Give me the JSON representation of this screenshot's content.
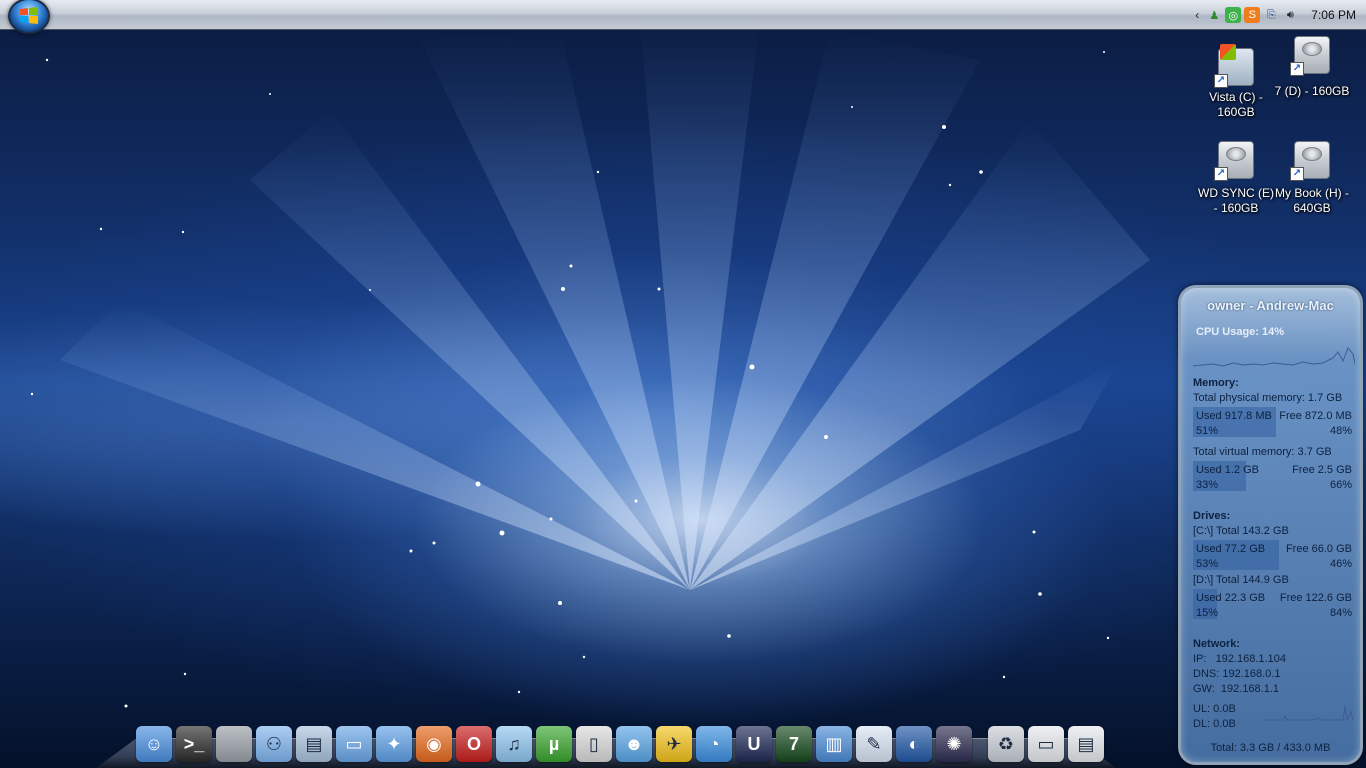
{
  "taskbar": {
    "clock": "7:06 PM",
    "tray_icons": [
      "chevron-left-icon",
      "users-icon",
      "spotify-icon",
      "skype-icon",
      "network-icon",
      "volume-icon"
    ]
  },
  "desktop_icons": [
    {
      "label": "Vista (C) - 160GB",
      "icon": "drive-icon"
    },
    {
      "label": "7 (D) - 160GB",
      "icon": "drive-icon"
    },
    {
      "label": "WD SYNC (E) - 160GB",
      "icon": "drive-icon"
    },
    {
      "label": "My Book (H) - 640GB",
      "icon": "drive-icon"
    }
  ],
  "gadget": {
    "title": "owner - Andrew-Mac",
    "cpu": "CPU Usage: 14%",
    "cpu_percent": 14,
    "memory": {
      "heading": "Memory:",
      "physical_total": "Total physical memory: 1.7 GB",
      "physical_used": "Used 917.8 MB",
      "physical_used_pct": "51%",
      "physical_free": "Free 872.0 MB",
      "physical_free_pct": "48%",
      "physical_fill": 0.51,
      "virtual_total": "Total virtual memory: 3.7 GB",
      "virtual_used": "Used 1.2 GB",
      "virtual_used_pct": "33%",
      "virtual_free": "Free 2.5 GB",
      "virtual_free_pct": "66%",
      "virtual_fill": 0.33
    },
    "drives": {
      "heading": "Drives:",
      "c_total": "[C:\\] Total 143.2 GB",
      "c_used": "Used 77.2 GB",
      "c_used_pct": "53%",
      "c_free": "Free 66.0 GB",
      "c_free_pct": "46%",
      "c_fill": 0.53,
      "d_total": "[D:\\] Total 144.9 GB",
      "d_used": "Used 22.3 GB",
      "d_used_pct": "15%",
      "d_free": "Free 122.6 GB",
      "d_free_pct": "84%",
      "d_fill": 0.15
    },
    "network": {
      "heading": "Network:",
      "ip": "IP:   192.168.1.104",
      "dns": "DNS: 192.168.0.1",
      "gw": "GW:  192.168.1.1",
      "ul": "UL: 0.0B",
      "dl": "DL: 0.0B"
    },
    "total": "Total: 3.3 GB / 433.0 MB"
  },
  "dock": [
    {
      "name": "finder-icon",
      "color": "#4a8fe0",
      "glyph": "☺"
    },
    {
      "name": "terminal-icon",
      "color": "#2b2b2b",
      "glyph": ">_"
    },
    {
      "name": "system-preferences-icon",
      "color": "#9aa0a8",
      "glyph": ""
    },
    {
      "name": "network-people-icon",
      "color": "#7fb4ee",
      "glyph": "⚇"
    },
    {
      "name": "documents-folder-icon",
      "color": "#a9c2dc",
      "glyph": "▤"
    },
    {
      "name": "folder-icon",
      "color": "#6aa6e8",
      "glyph": "▭"
    },
    {
      "name": "safari-icon",
      "color": "#5ea0e6",
      "glyph": "✦"
    },
    {
      "name": "firefox-icon",
      "color": "#e66a1d",
      "glyph": "◉"
    },
    {
      "name": "opera-icon",
      "color": "#c81e1e",
      "glyph": "O"
    },
    {
      "name": "itunes-icon",
      "color": "#8ec4ee",
      "glyph": "♫"
    },
    {
      "name": "utorrent-icon",
      "color": "#3aa52f",
      "glyph": "µ"
    },
    {
      "name": "ipod-icon",
      "color": "#d9d9d9",
      "glyph": "▯"
    },
    {
      "name": "messenger-icon",
      "color": "#59a6e6",
      "glyph": "☻"
    },
    {
      "name": "aim-icon",
      "color": "#f2c21b",
      "glyph": "✈"
    },
    {
      "name": "skype-icon",
      "color": "#3b8fe0",
      "glyph": "◔"
    },
    {
      "name": "unreal-tournament-icon",
      "color": "#1f2a56",
      "glyph": "U"
    },
    {
      "name": "fallout-icon",
      "color": "#174a1d",
      "glyph": "7"
    },
    {
      "name": "file-folder-icon",
      "color": "#4b8cd6",
      "glyph": "▥"
    },
    {
      "name": "preview-icon",
      "color": "#d7e3f2",
      "glyph": "✎"
    },
    {
      "name": "google-earth-icon",
      "color": "#2258a6",
      "glyph": "◐"
    },
    {
      "name": "blender-icon",
      "color": "#2d2d52",
      "glyph": "✺"
    },
    {
      "name": "trash-icon",
      "color": "#c8ced6",
      "glyph": "♻"
    },
    {
      "name": "window-thumbnail-icon",
      "color": "#e6e8ec",
      "glyph": "▭"
    },
    {
      "name": "window-thumbnail-icon",
      "color": "#e6e8ec",
      "glyph": "▤"
    }
  ]
}
